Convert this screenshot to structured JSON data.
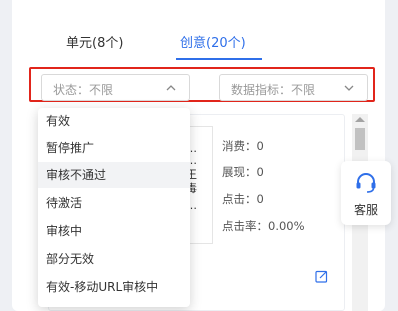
{
  "tabs": {
    "units_label": "单元(8个)",
    "creative_label": "创意(20个)"
  },
  "filters": {
    "status_label": "状态：不限",
    "metric_label": "数据指标：不限"
  },
  "dropdown": {
    "options": [
      "有效",
      "暂停推广",
      "审核不通过",
      "待激活",
      "审核中",
      "部分无效",
      "有效-移动URL审核中"
    ],
    "highlighted_index": 2
  },
  "creative_card": {
    "thumb_lines": [
      "…",
      "…",
      "王",
      "毒",
      "…"
    ],
    "metrics": {
      "spend": "消费：0",
      "impressions": "展现：0",
      "clicks": "点击：0",
      "ctr": "点击率：0.00%"
    }
  },
  "service": {
    "label": "客服"
  },
  "colors": {
    "accent": "#2f6fe9",
    "highlight_border": "#e1251b"
  }
}
